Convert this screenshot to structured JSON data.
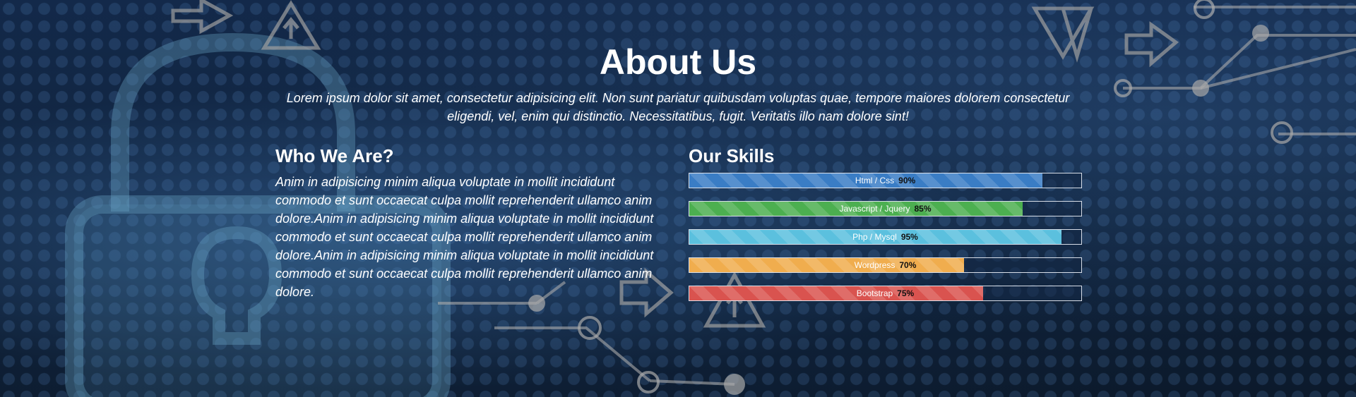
{
  "header": {
    "title": "About Us",
    "intro": "Lorem ipsum dolor sit amet, consectetur adipisicing elit. Non sunt pariatur quibusdam voluptas quae, tempore maiores dolorem consectetur eligendi, vel, enim qui distinctio. Necessitatibus, fugit. Veritatis illo nam dolore sint!"
  },
  "who": {
    "title": "Who We Are?",
    "text": "Anim in adipisicing minim aliqua voluptate in mollit incididunt commodo et sunt occaecat culpa mollit reprehenderit ullamco anim dolore.Anim in adipisicing minim aliqua voluptate in mollit incididunt commodo et sunt occaecat culpa mollit reprehenderit ullamco anim dolore.Anim in adipisicing minim aliqua voluptate in mollit incididunt commodo et sunt occaecat culpa mollit reprehenderit ullamco anim dolore."
  },
  "skills": {
    "title": "Our Skills",
    "items": [
      {
        "label": "Html / Css",
        "percent": "90%",
        "value": 90,
        "color": "#3a7dc5"
      },
      {
        "label": "Javascript / Jquery",
        "percent": "85%",
        "value": 85,
        "color": "#4caf50"
      },
      {
        "label": "Php / Mysql",
        "percent": "95%",
        "value": 95,
        "color": "#5bc0de"
      },
      {
        "label": "Wordpress",
        "percent": "70%",
        "value": 70,
        "color": "#f0ad4e"
      },
      {
        "label": "Bootstrap",
        "percent": "75%",
        "value": 75,
        "color": "#d9534f"
      }
    ]
  },
  "background": {
    "icons": [
      "padlock-icon",
      "arrow-right-icon",
      "arrow-left-icon",
      "warning-triangle-icon",
      "circuit-lines"
    ]
  }
}
